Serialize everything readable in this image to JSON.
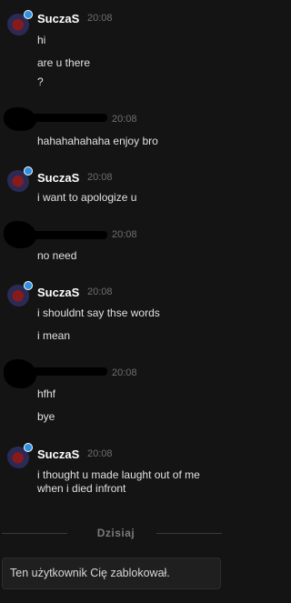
{
  "messages": [
    {
      "author": "SuczaS",
      "time": "20:08",
      "censored": false,
      "lines": [
        "hi",
        "are u there",
        "?"
      ]
    },
    {
      "author": "",
      "time": "20:08",
      "censored": true,
      "lines": [
        "hahahahahaha enjoy bro"
      ]
    },
    {
      "author": "SuczaS",
      "time": "20:08",
      "censored": false,
      "lines": [
        "i want to apologize u"
      ]
    },
    {
      "author": "",
      "time": "20:08",
      "censored": true,
      "lines": [
        "no need"
      ]
    },
    {
      "author": "SuczaS",
      "time": "20:08",
      "censored": false,
      "lines": [
        "i shouldnt say thse words",
        "i mean"
      ]
    },
    {
      "author": "",
      "time": "20:08",
      "censored": true,
      "lines": [
        "hfhf",
        "bye"
      ]
    },
    {
      "author": "SuczaS",
      "time": "20:08",
      "censored": false,
      "lines": [
        "i thought u made laught out of me",
        "when i died infront"
      ]
    }
  ],
  "divider": "Dzisiaj",
  "notice": "Ten użytkownik Cię zablokował."
}
